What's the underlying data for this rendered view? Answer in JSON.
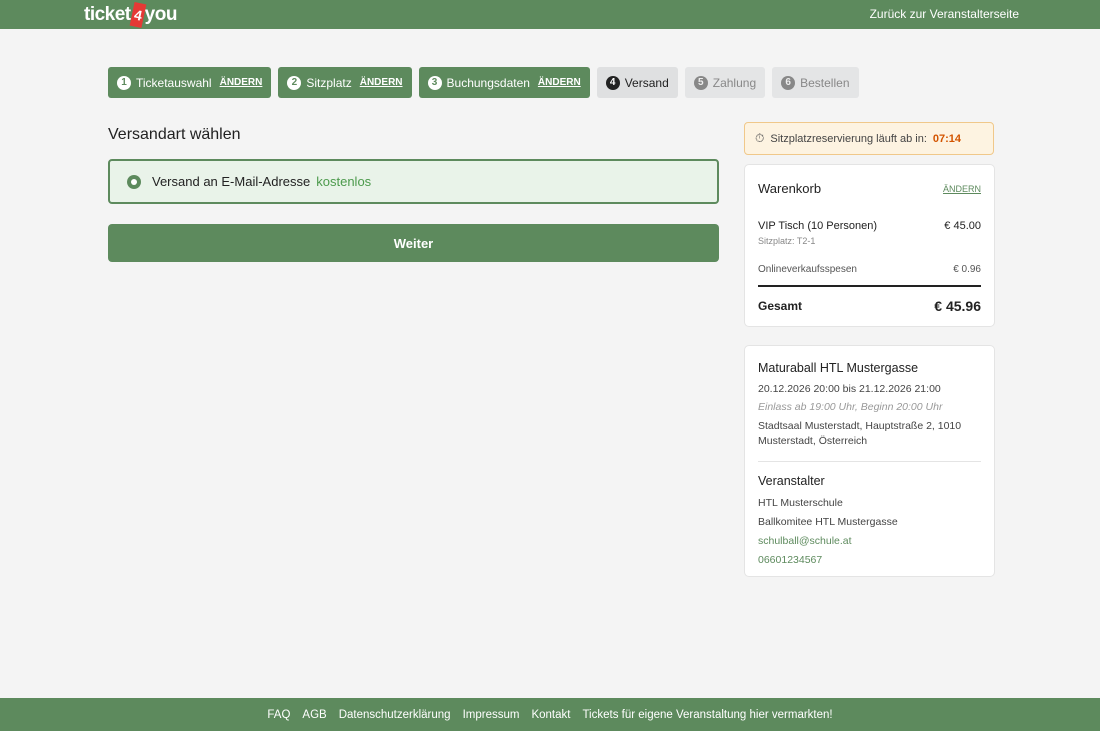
{
  "header": {
    "logo": {
      "part1": "ticket",
      "part2": "4",
      "part3": "you"
    },
    "back_link": "Zurück zur Veranstalterseite"
  },
  "steps": [
    {
      "num": "1",
      "label": "Ticketauswahl",
      "edit": "ÄNDERN",
      "state": "done"
    },
    {
      "num": "2",
      "label": "Sitzplatz",
      "edit": "ÄNDERN",
      "state": "done"
    },
    {
      "num": "3",
      "label": "Buchungsdaten",
      "edit": "ÄNDERN",
      "state": "done"
    },
    {
      "num": "4",
      "label": "Versand",
      "edit": "",
      "state": "current"
    },
    {
      "num": "5",
      "label": "Zahlung",
      "edit": "",
      "state": "future"
    },
    {
      "num": "6",
      "label": "Bestellen",
      "edit": "",
      "state": "future"
    }
  ],
  "main": {
    "title": "Versandart wählen",
    "option_label": "Versand an E-Mail-Adresse",
    "option_price": "kostenlos",
    "next_button": "Weiter"
  },
  "timer": {
    "label": "Sitzplatzreservierung läuft ab in:",
    "time": "07:14"
  },
  "cart": {
    "title": "Warenkorb",
    "edit": "ÄNDERN",
    "item_name": "VIP Tisch (10 Personen)",
    "item_price": "€ 45.00",
    "item_seat": "Sitzplatz: T2-1",
    "fee_label": "Onlineverkaufsspesen",
    "fee_price": "€ 0.96",
    "total_label": "Gesamt",
    "total_price": "€ 45.96"
  },
  "event": {
    "title": "Maturaball HTL Mustergasse",
    "date": "20.12.2026 20:00 bis 21.12.2026 21:00",
    "entry": "Einlass ab 19:00 Uhr, Beginn 20:00 Uhr",
    "venue": "Stadtsaal Musterstadt, Hauptstraße 2, 1010 Musterstadt, Österreich",
    "organizer_title": "Veranstalter",
    "organizer_name": "HTL Musterschule",
    "organizer_committee": "Ballkomitee HTL Mustergasse",
    "organizer_email": "schulball@schule.at",
    "organizer_phone": "06601234567"
  },
  "footer": {
    "links": [
      "FAQ",
      "AGB",
      "Datenschutzerklärung",
      "Impressum",
      "Kontakt",
      "Tickets für eigene Veranstaltung hier vermarkten!"
    ]
  },
  "colors": {
    "brand": "#5d8a5d",
    "logo_accent": "#e53935",
    "timer_accent": "#d35400"
  }
}
